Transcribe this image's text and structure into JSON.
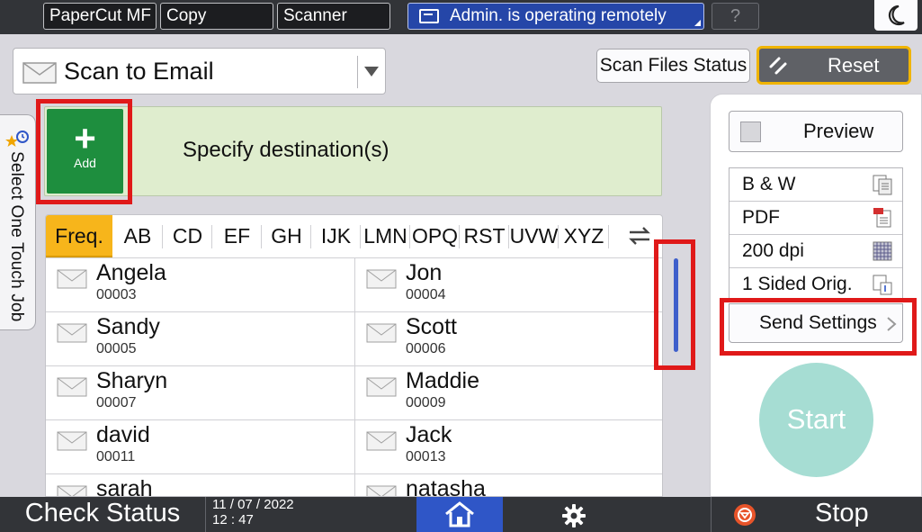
{
  "topbar": {
    "apps": [
      "PaperCut MF",
      "Copy",
      "Scanner"
    ],
    "remote_status": "Admin. is operating remotely",
    "help_label": "?",
    "night_icon": "moon-icon"
  },
  "function": {
    "label": "Scan to Email",
    "icon": "envelope-icon"
  },
  "buttons": {
    "scan_files_status": "Scan Files Status",
    "reset": "Reset",
    "add": "Add",
    "add_symbol": "+"
  },
  "destination": {
    "prompt": "Specify destination(s)"
  },
  "side_tab": {
    "label": "Select One Touch Job"
  },
  "address_book": {
    "tabs": [
      "Freq.",
      "AB",
      "CD",
      "EF",
      "GH",
      "IJK",
      "LMN",
      "OPQ",
      "RST",
      "UVW",
      "XYZ"
    ],
    "selected_tab": "Freq.",
    "entries": [
      {
        "name": "Angela",
        "id": "00003"
      },
      {
        "name": "Jon",
        "id": "00004"
      },
      {
        "name": "Sandy",
        "id": "00005"
      },
      {
        "name": "Scott",
        "id": "00006"
      },
      {
        "name": "Sharyn",
        "id": "00007"
      },
      {
        "name": "Maddie",
        "id": "00009"
      },
      {
        "name": "david",
        "id": "00011"
      },
      {
        "name": "Jack",
        "id": "00013"
      },
      {
        "name": "sarah",
        "id": ""
      },
      {
        "name": "natasha",
        "id": ""
      }
    ]
  },
  "right_panel": {
    "preview": "Preview",
    "settings": [
      "B & W",
      "PDF",
      "200 dpi",
      "1 Sided Orig."
    ],
    "send_settings": "Send Settings",
    "start": "Start"
  },
  "bottombar": {
    "check_status": "Check Status",
    "date": "11 / 07 / 2022",
    "time": "12 : 47",
    "stop": "Stop"
  },
  "colors": {
    "highlight": "#e01919",
    "accent_green": "#1e8e3e",
    "tab_selected": "#f7b51b",
    "home_blue": "#2f56c7",
    "start_teal": "#a6ddd3"
  }
}
